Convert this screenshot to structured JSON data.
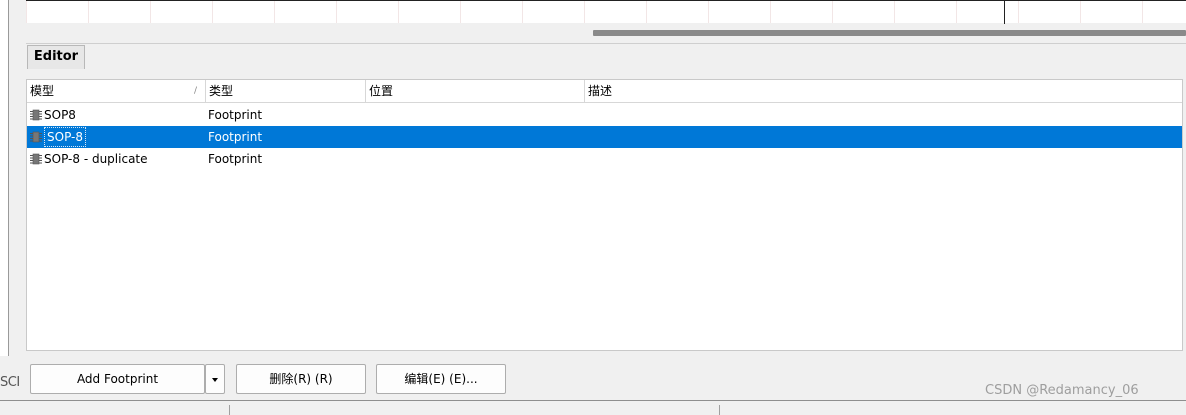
{
  "left_panel": {
    "partial_label": "SCI"
  },
  "editor": {
    "tab_label": "Editor"
  },
  "table": {
    "columns": [
      "模型",
      "类型",
      "位置",
      "描述"
    ],
    "rows": [
      {
        "model": "SOP8",
        "type": "Footprint",
        "location": "",
        "description": "",
        "selected": false
      },
      {
        "model": "SOP-8",
        "type": "Footprint",
        "location": "",
        "description": "",
        "selected": true
      },
      {
        "model": "SOP-8 - duplicate",
        "type": "Footprint",
        "location": "",
        "description": "",
        "selected": false
      }
    ]
  },
  "buttons": {
    "add_footprint": "Add Footprint",
    "delete": "删除(R) (R)",
    "edit": "编辑(E) (E)..."
  },
  "watermark": {
    "text": "CSDN @Redamancy_06"
  },
  "colors": {
    "selection": "#0078d7",
    "selection_text": "#ffffff",
    "panel_bg": "#f0f0f0"
  },
  "icons": {
    "row_icon": "footprint-chip-icon",
    "dropdown": "chevron-down-icon",
    "sort": "sort-indicator-icon"
  }
}
